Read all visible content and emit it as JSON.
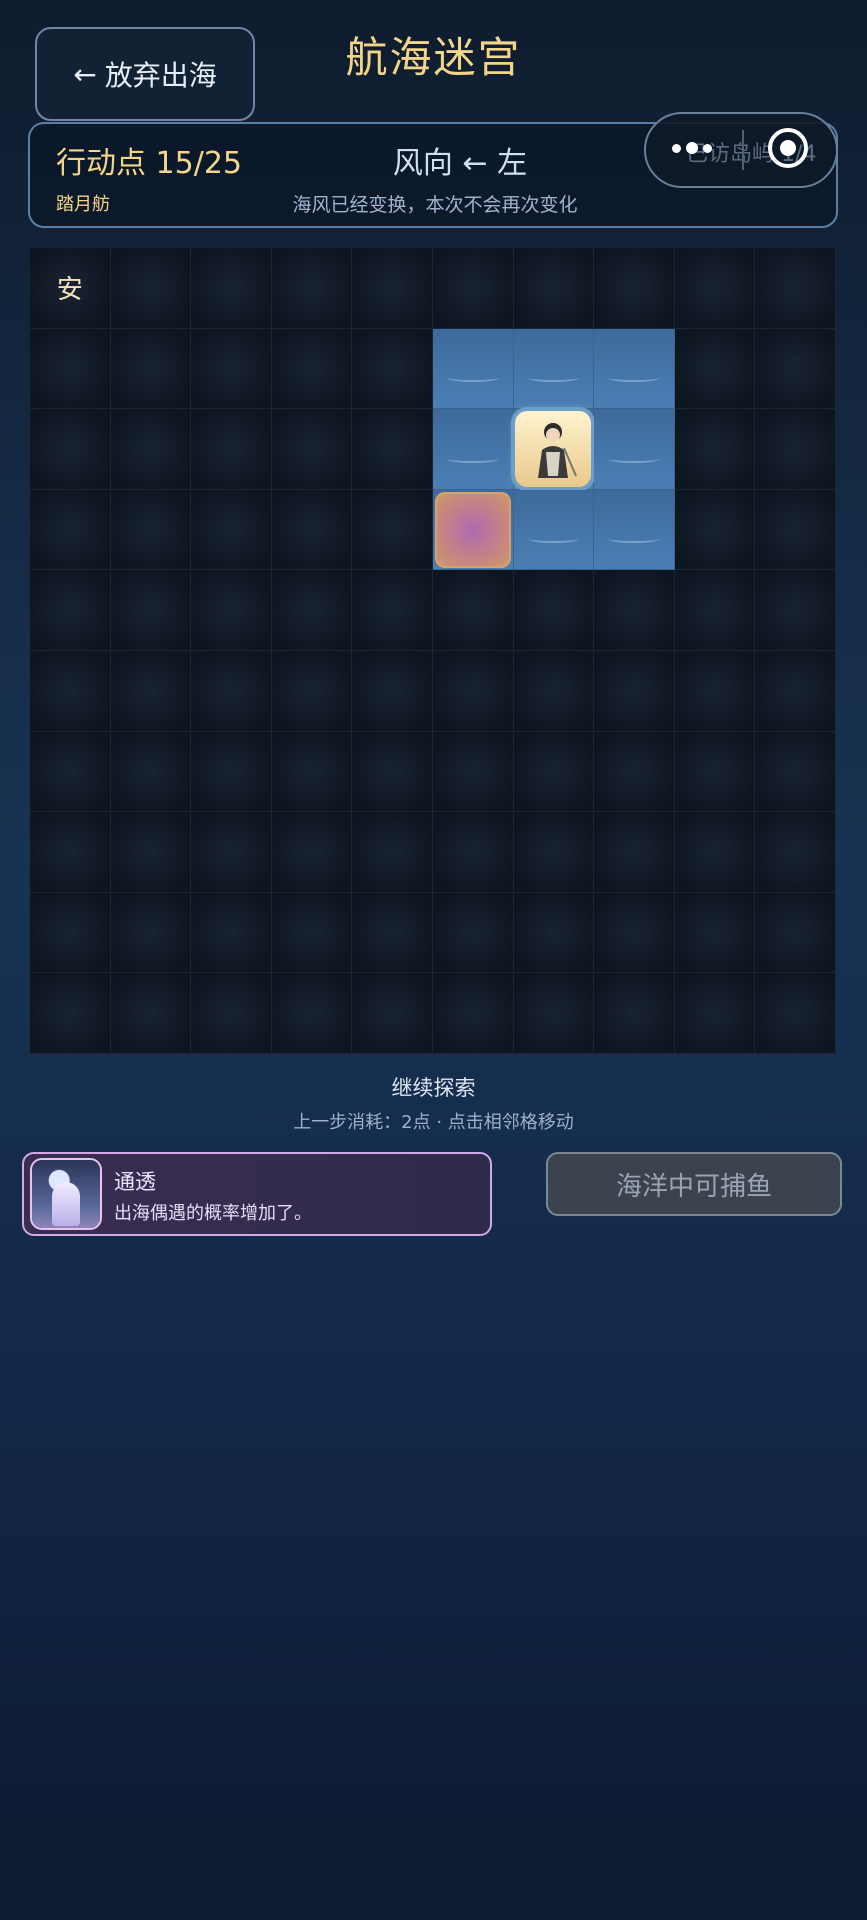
{
  "header": {
    "back_label": "放弃出海",
    "title": "航海迷宫"
  },
  "status": {
    "action_points": "行动点 15/25",
    "boat_name": "踏月舫",
    "wind": "风向 ← 左",
    "wind_note": "海风已经变换，本次不会再次变化",
    "visited_islands": "已访岛屿 1/4"
  },
  "grid": {
    "safe_mark": "安"
  },
  "footer": {
    "explore_label": "继续探索",
    "cost_hint": "上一步消耗：2点 · 点击相邻格移动"
  },
  "buff": {
    "title": "通透",
    "desc": "出海偶遇的概率增加了。"
  },
  "fish_button": {
    "label": "海洋中可捕鱼"
  },
  "colors": {
    "accent_gold": "#f3d58a",
    "water": "#4b7fb4",
    "buff_border": "#d4a8e8"
  }
}
